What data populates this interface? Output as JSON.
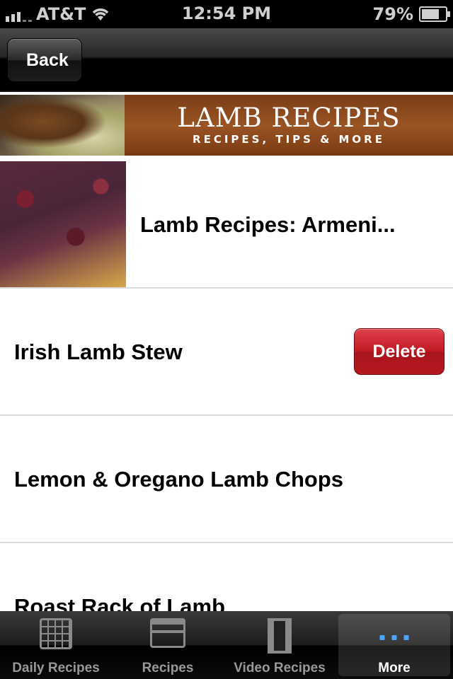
{
  "status_bar": {
    "carrier": "AT&T",
    "time": "12:54 PM",
    "battery": "79%",
    "battery_level": 0.79
  },
  "navbar": {
    "back_label": "Back"
  },
  "banner": {
    "title": "LAMB RECIPES",
    "subtitle": "RECIPES, TIPS & MORE"
  },
  "list": {
    "featured": {
      "label": "Lamb Recipes: Armeni..."
    },
    "items": [
      {
        "label": "Irish Lamb Stew",
        "delete_label": "Delete"
      },
      {
        "label": "Lemon & Oregano Lamb Chops"
      },
      {
        "label": "Roast Rack of Lamb"
      }
    ]
  },
  "tabbar": {
    "tabs": [
      {
        "label": "Daily Recipes",
        "icon": "calendar-icon"
      },
      {
        "label": "Recipes",
        "icon": "inbox-tray-icon"
      },
      {
        "label": "Video Recipes",
        "icon": "film-strip-icon"
      },
      {
        "label": "More",
        "icon": "more-dots-icon",
        "active": true
      }
    ]
  }
}
